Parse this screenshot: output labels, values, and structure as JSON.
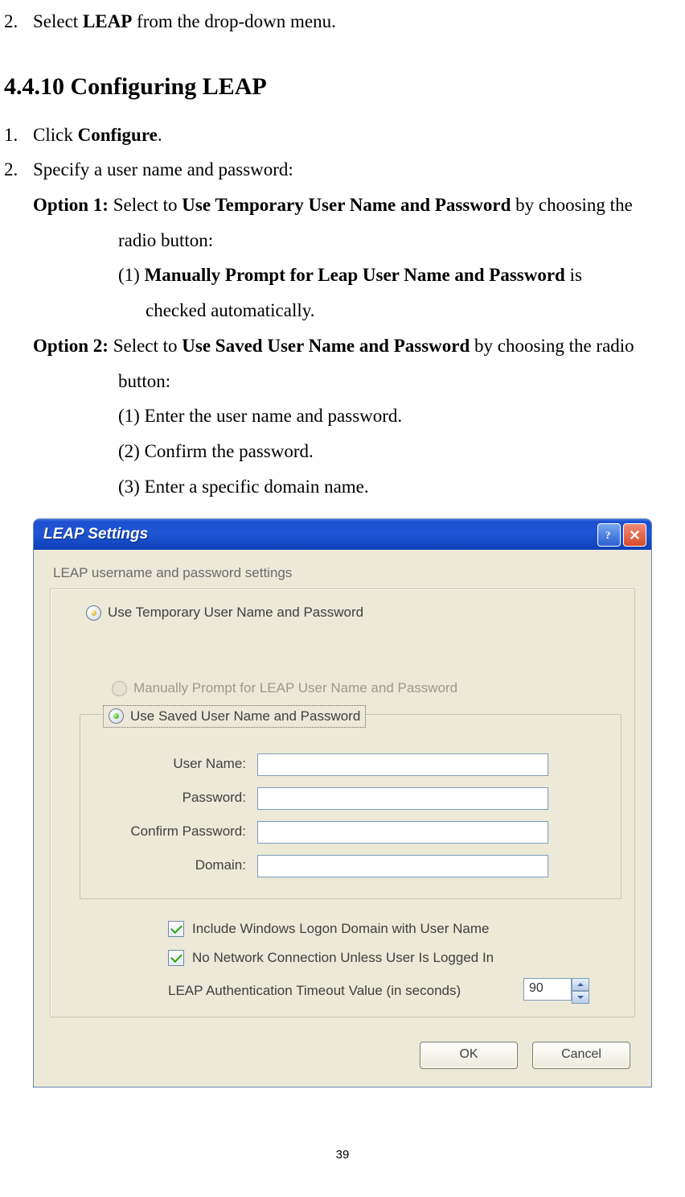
{
  "intro": {
    "num": "2.",
    "pre": "Select ",
    "bold": "LEAP",
    "post": " from the drop-down menu."
  },
  "heading": "4.4.10 Configuring LEAP",
  "step1": {
    "num": "1.",
    "pre": "Click ",
    "bold": "Configure",
    "post": "."
  },
  "step2": {
    "num": "2.",
    "text": "Specify a user name and password:"
  },
  "opt1": {
    "label": "Option 1:",
    "pre": " Select to ",
    "bold": "Use Temporary User Name and Password",
    "post": " by choosing the",
    "line2": "radio button:",
    "sub_pre": "(1) ",
    "sub_bold": "Manually Prompt for Leap User Name and Password",
    "sub_post": " is",
    "sub_line2": "checked automatically."
  },
  "opt2": {
    "label": "Option 2:",
    "pre": " Select to ",
    "bold": "Use Saved User Name and Password",
    "post": " by choosing the radio",
    "line2": "button:",
    "s1": "(1) Enter the user name and password.",
    "s2": "(2) Confirm the password.",
    "s3": "(3) Enter a specific domain name."
  },
  "dialog": {
    "title": "LEAP Settings",
    "section_label": "LEAP username and password settings",
    "radio_temp": "Use Temporary User Name and Password",
    "radio_manual": "Manually Prompt for LEAP User Name and Password",
    "radio_saved": "Use Saved User Name and Password",
    "f_user": "User Name:",
    "f_pass": "Password:",
    "f_confirm": "Confirm Password:",
    "f_domain": "Domain:",
    "chk1": "Include Windows Logon Domain with User Name",
    "chk2": "No Network Connection Unless User Is Logged In",
    "timeout_label": "LEAP Authentication Timeout Value (in seconds)",
    "timeout_value": "90",
    "ok": "OK",
    "cancel": "Cancel"
  },
  "page_num": "39"
}
